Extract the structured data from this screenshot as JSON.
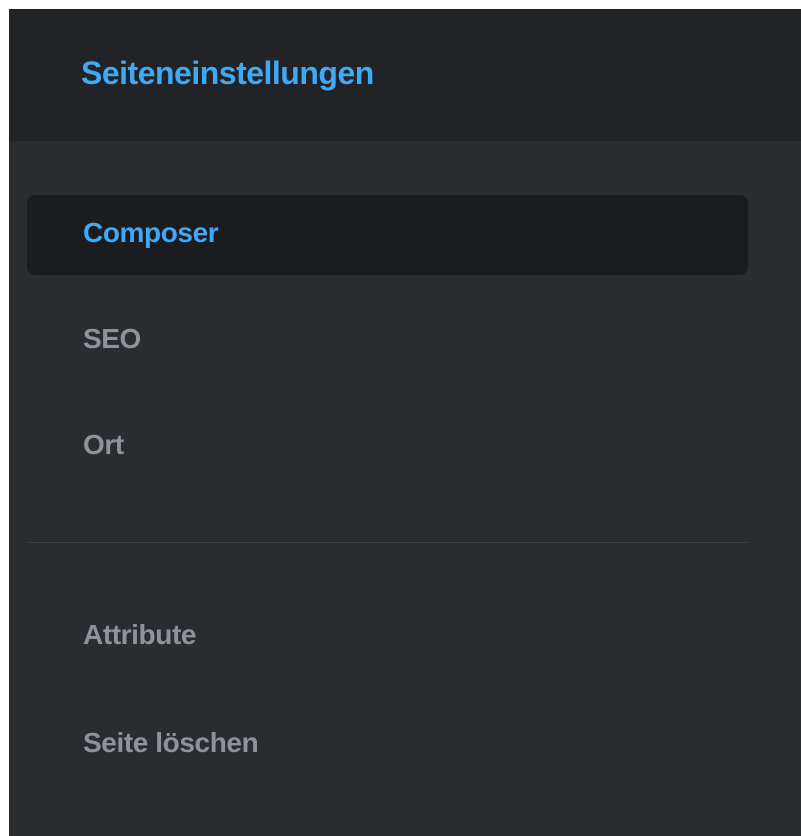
{
  "panel": {
    "title": "Seiteneinstellungen",
    "accent_color": "#3fa9f5",
    "menu": [
      {
        "label": "Composer",
        "active": true
      },
      {
        "label": "SEO",
        "active": false
      },
      {
        "label": "Ort",
        "active": false
      }
    ],
    "secondary_menu": [
      {
        "label": "Attribute",
        "active": false
      },
      {
        "label": "Seite löschen",
        "active": false
      }
    ]
  }
}
